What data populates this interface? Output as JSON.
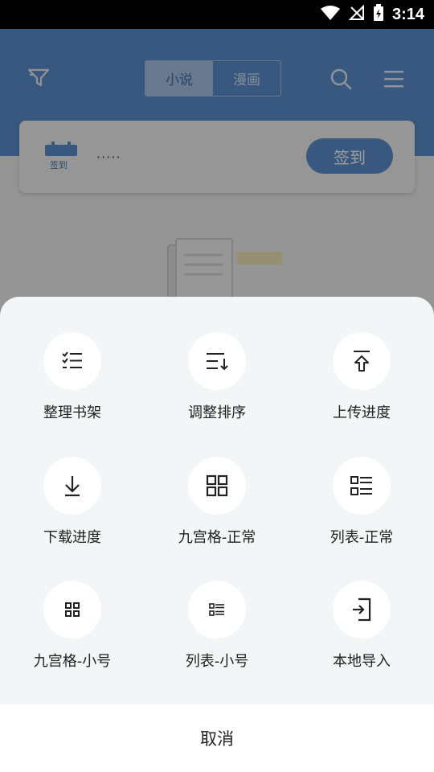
{
  "status_bar": {
    "time": "3:14"
  },
  "header": {
    "tabs": [
      {
        "label": "小说",
        "active": true
      },
      {
        "label": "漫画",
        "active": false
      }
    ]
  },
  "sign_card": {
    "calendar_label": "签到",
    "text": "·····",
    "button_label": "签到"
  },
  "menu_items": [
    {
      "label": "整理书架",
      "icon": "checklist-icon"
    },
    {
      "label": "调整排序",
      "icon": "sort-icon"
    },
    {
      "label": "上传进度",
      "icon": "upload-icon"
    },
    {
      "label": "下载进度",
      "icon": "download-icon"
    },
    {
      "label": "九宫格-正常",
      "icon": "grid-icon"
    },
    {
      "label": "列表-正常",
      "icon": "list-icon"
    },
    {
      "label": "九宫格-小号",
      "icon": "grid-small-icon"
    },
    {
      "label": "列表-小号",
      "icon": "list-small-icon"
    },
    {
      "label": "本地导入",
      "icon": "import-icon"
    }
  ],
  "cancel_label": "取消",
  "colors": {
    "header_blue": "#5b8fcd",
    "sheet_bg": "#f4f5f7",
    "icon_bg": "#ffffff"
  }
}
